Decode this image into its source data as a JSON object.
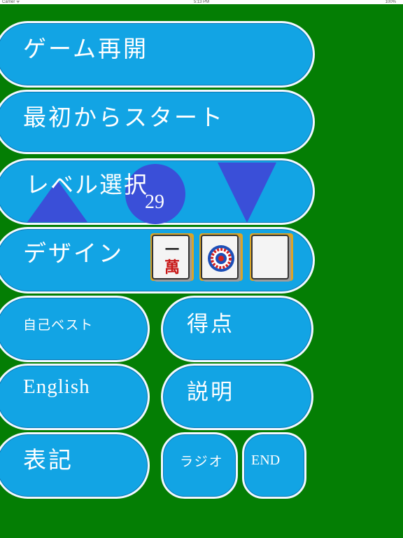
{
  "status_bar": {
    "carrier": "Carrier ᯤ",
    "time": "5:13 PM",
    "battery": "100%"
  },
  "menu": {
    "resume": "ゲーム再開",
    "restart": "最初からスタート",
    "level_label": "レベル選択",
    "level_value": "29",
    "design_label": "デザイン",
    "personal_best": "自己ベスト",
    "score": "得点",
    "english": "English",
    "explanation": "説明",
    "notation": "表記",
    "radio": "ラジオ",
    "end": "END"
  },
  "design_tiles": [
    {
      "icon": "character-1-man-tile-icon",
      "top_char": "一",
      "bottom_char": "萬"
    },
    {
      "icon": "circle-1-pin-tile-icon"
    },
    {
      "icon": "white-dragon-tile-icon"
    }
  ],
  "colors": {
    "background": "#047e04",
    "button": "#12a4e4",
    "level_control": "#3a4fd8",
    "tile_back": "#d9a428"
  }
}
